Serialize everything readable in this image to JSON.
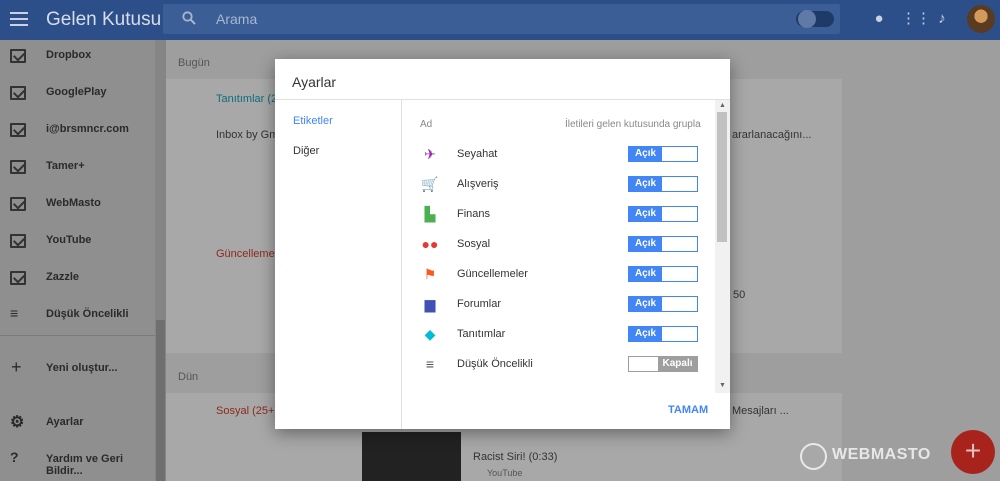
{
  "topbar": {
    "title": "Gelen Kutusu",
    "search_placeholder": "Arama"
  },
  "sidebar": {
    "items": [
      {
        "label": "Dropbox",
        "icon": "inbox-icon"
      },
      {
        "label": "GooglePlay",
        "icon": "inbox-icon"
      },
      {
        "label": "i@brsmncr.com",
        "icon": "inbox-icon"
      },
      {
        "label": "Tamer+",
        "icon": "inbox-icon"
      },
      {
        "label": "WebMasto",
        "icon": "inbox-icon"
      },
      {
        "label": "YouTube",
        "icon": "inbox-icon"
      },
      {
        "label": "Zazzle",
        "icon": "inbox-icon"
      },
      {
        "label": "Düşük Öncelikli",
        "icon": "low-priority-icon"
      }
    ],
    "create_label": "Yeni oluştur...",
    "settings_label": "Ayarlar",
    "help_label": "Yardım ve Geri Bildir..."
  },
  "main": {
    "today_label": "Bugün",
    "yesterday_label": "Dün",
    "rows": {
      "promotions": "Tanıtımlar (2",
      "inbox_by_gmail": "Inbox by Gma",
      "updates": "Güncellemeler",
      "social": "Sosyal (25+)",
      "right_snippet1": "ararlanacağını...",
      "right_snippet2": "Mesajları ...",
      "number_snippet": "50",
      "video_title": "Racist Siri! (0:33)",
      "video_source": "YouTube"
    }
  },
  "modal": {
    "title": "Ayarlar",
    "nav": [
      {
        "label": "Etiketler",
        "active": true
      },
      {
        "label": "Diğer",
        "active": false
      }
    ],
    "col_name": "Ad",
    "col_group": "İletileri gelen kutusunda grupla",
    "on_label": "Açık",
    "off_label": "Kapalı",
    "rows": [
      {
        "label": "Seyahat",
        "icon": "plane-icon",
        "color": "#9c27b0",
        "on": true
      },
      {
        "label": "Alışveriş",
        "icon": "cart-icon",
        "color": "#795548",
        "on": true
      },
      {
        "label": "Finans",
        "icon": "chart-icon",
        "color": "#4caf50",
        "on": true
      },
      {
        "label": "Sosyal",
        "icon": "people-icon",
        "color": "#e53935",
        "on": true
      },
      {
        "label": "Güncellemeler",
        "icon": "flag-icon",
        "color": "#ff5722",
        "on": true
      },
      {
        "label": "Forumlar",
        "icon": "forum-icon",
        "color": "#3f51b5",
        "on": true
      },
      {
        "label": "Tanıtımlar",
        "icon": "tag-icon",
        "color": "#00bcd4",
        "on": true
      },
      {
        "label": "Düşük Öncelikli",
        "icon": "low-priority-icon",
        "color": "#555555",
        "on": false
      }
    ],
    "done_label": "TAMAM"
  },
  "watermark": "WEBMASTO",
  "colors": {
    "accent": "#4285f4",
    "topbar": "#2c4f8a",
    "fab": "#a8231b"
  }
}
